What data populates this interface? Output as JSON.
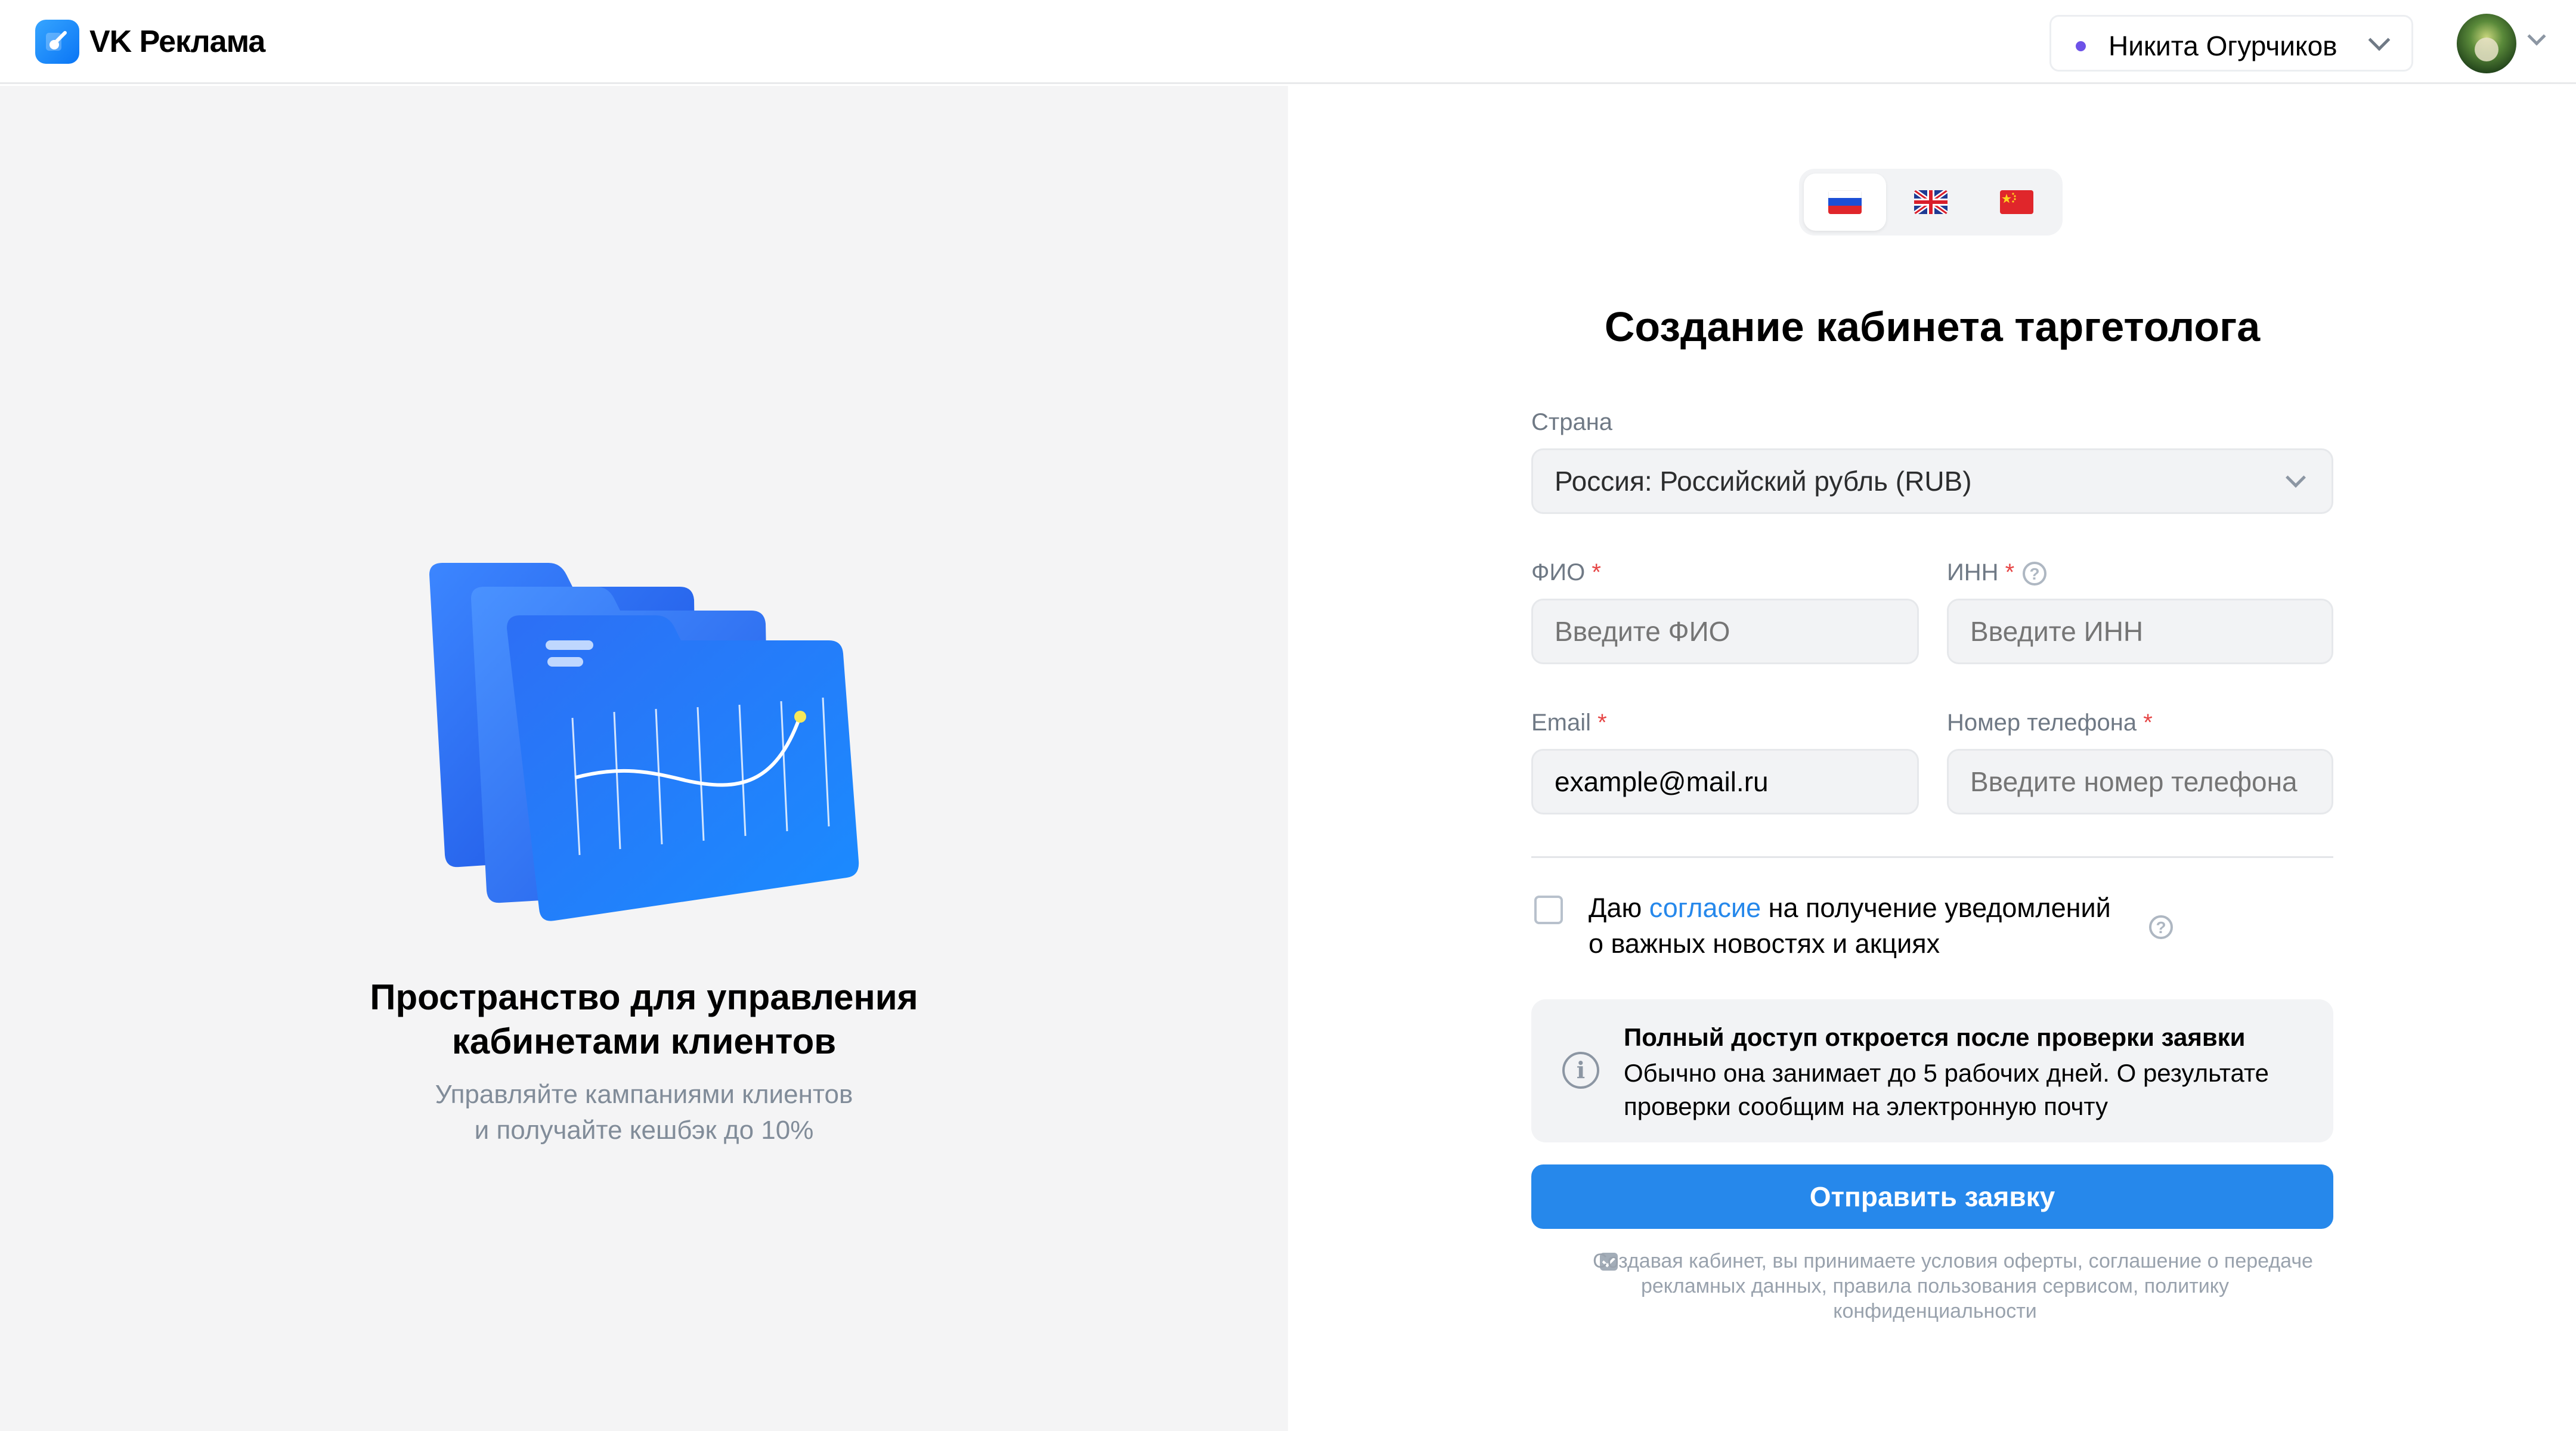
{
  "header": {
    "brand": "VK Реклама",
    "account_name": "Никита Огурчиков"
  },
  "left": {
    "title_line1": "Пространство для управления",
    "title_line2": "кабинетами клиентов",
    "subtitle_line1": "Управляйте кампаниями клиентов",
    "subtitle_line2": "и получайте кешбэк до 10%"
  },
  "languages": [
    {
      "icon": "russia-flag-icon",
      "active": true
    },
    {
      "icon": "uk-flag-icon",
      "active": false
    },
    {
      "icon": "china-flag-icon",
      "active": false
    }
  ],
  "form": {
    "title": "Создание кабинета таргетолога",
    "country": {
      "label": "Страна",
      "value": "Россия: Российский рубль (RUB)"
    },
    "fio": {
      "label": "ФИО",
      "placeholder": "Введите ФИО"
    },
    "inn": {
      "label": "ИНН",
      "placeholder": "Введите ИНН"
    },
    "email": {
      "label": "Email",
      "value": "example@mail.ru"
    },
    "phone": {
      "label": "Номер телефона",
      "placeholder": "Введите номер телефона"
    },
    "required_mark": "*",
    "consent": {
      "prefix": "Даю ",
      "link": "согласие",
      "suffix": " на получение уведомлений",
      "line2": "о важных новостях и акциях"
    },
    "info": {
      "title": "Полный доступ откроется после проверки заявки",
      "text": "Обычно она занимает до 5 рабочих дней. О результате проверки сообщим на электронную почту"
    },
    "submit_label": "Отправить заявку",
    "terms": "Создавая кабинет, вы принимаете условия оферты, соглашение о передаче рекламных данных, правила пользования сервисом, политику конфиденциальности"
  },
  "colors": {
    "accent": "#2688eb",
    "required": "#e64646",
    "left_bg": "#f4f4f5"
  }
}
